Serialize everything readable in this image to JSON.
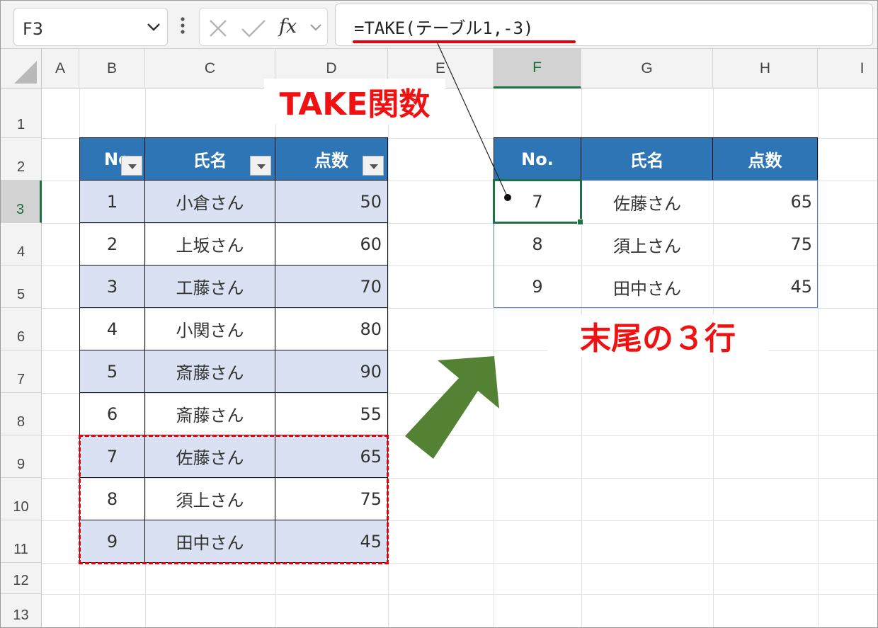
{
  "name_box": {
    "value": "F3"
  },
  "formula_bar": {
    "formula": "=TAKE(テーブル1,-3)",
    "cancel_icon": "close-icon",
    "enter_icon": "check-icon",
    "function_icon": "fx"
  },
  "columns": [
    "A",
    "B",
    "C",
    "D",
    "E",
    "F",
    "G",
    "H",
    "I"
  ],
  "rows": [
    "1",
    "2",
    "3",
    "4",
    "5",
    "6",
    "7",
    "8",
    "9",
    "10",
    "11",
    "12",
    "13"
  ],
  "selected_column": "F",
  "selected_row": "3",
  "source_table": {
    "headers": [
      "No",
      "氏名",
      "点数"
    ],
    "rows": [
      [
        "1",
        "小倉さん",
        "50"
      ],
      [
        "2",
        "上坂さん",
        "60"
      ],
      [
        "3",
        "工藤さん",
        "70"
      ],
      [
        "4",
        "小関さん",
        "80"
      ],
      [
        "5",
        "斎藤さん",
        "90"
      ],
      [
        "6",
        "斎藤さん",
        "55"
      ],
      [
        "7",
        "佐藤さん",
        "65"
      ],
      [
        "8",
        "須上さん",
        "75"
      ],
      [
        "9",
        "田中さん",
        "45"
      ]
    ],
    "header_color": "#2e75b6",
    "band_color": "#d9e1f2"
  },
  "result_table": {
    "headers": [
      "No.",
      "氏名",
      "点数"
    ],
    "rows": [
      [
        "7",
        "佐藤さん",
        "65"
      ],
      [
        "8",
        "須上さん",
        "75"
      ],
      [
        "9",
        "田中さん",
        "45"
      ]
    ]
  },
  "annotations": {
    "take_label": "TAKE関数",
    "tail_label": "末尾の３行",
    "annotation_color": "#f01212",
    "arrow_color": "#548235"
  }
}
